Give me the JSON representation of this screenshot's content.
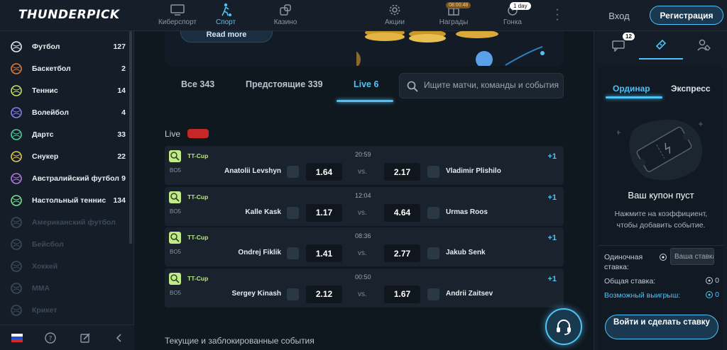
{
  "header": {
    "logo": "THUNDERPICK",
    "nav": [
      {
        "label": "Киберспорт",
        "icon": "monitor-icon"
      },
      {
        "label": "Спорт",
        "icon": "soccer-player-icon"
      },
      {
        "label": "Казино",
        "icon": "dice-icon"
      },
      {
        "label": "Акции",
        "icon": "gear-icon"
      },
      {
        "label": "Награды",
        "icon": "gift-icon",
        "badge": "08:00:48"
      },
      {
        "label": "Гонка",
        "icon": "stopwatch-icon",
        "badge": "1 day"
      }
    ],
    "login": "Вход",
    "register": "Регистрация"
  },
  "sidebar": {
    "sports": [
      {
        "name": "Футбол",
        "count": "127",
        "icon": "soccer-ball-icon"
      },
      {
        "name": "Баскетбол",
        "count": "2",
        "icon": "basketball-icon"
      },
      {
        "name": "Теннис",
        "count": "14",
        "icon": "tennis-icon"
      },
      {
        "name": "Волейбол",
        "count": "4",
        "icon": "volleyball-icon"
      },
      {
        "name": "Дартс",
        "count": "33",
        "icon": "darts-icon"
      },
      {
        "name": "Снукер",
        "count": "22",
        "icon": "snooker-icon"
      },
      {
        "name": "Австралийский футбол",
        "count": "9",
        "icon": "aussie-football-icon"
      },
      {
        "name": "Настольный теннис",
        "count": "134",
        "icon": "table-tennis-icon"
      },
      {
        "name": "Американский футбол",
        "count": "",
        "icon": "american-football-icon"
      },
      {
        "name": "Бейсбол",
        "count": "",
        "icon": "baseball-icon"
      },
      {
        "name": "Хоккей",
        "count": "",
        "icon": "hockey-icon"
      },
      {
        "name": "MMA",
        "count": "",
        "icon": "mma-icon"
      },
      {
        "name": "Крикет",
        "count": "",
        "icon": "cricket-icon"
      }
    ]
  },
  "main": {
    "banner_button": "Read more",
    "tabs": [
      {
        "label": "Все 343"
      },
      {
        "label": "Предстоящие 339"
      },
      {
        "label": "Live 6"
      }
    ],
    "search_placeholder": "Ищите матчи, команды и события",
    "live_label": "Live",
    "matches": [
      {
        "league": "TT-Cup",
        "format": "BO5",
        "time": "20:59",
        "home": "Anatolii Levshyn",
        "away": "Vladimir Plishilo",
        "odd_home": "1.64",
        "odd_away": "2.17",
        "more": "+1",
        "vs": "vs."
      },
      {
        "league": "TT-Cup",
        "format": "BO5",
        "time": "12:04",
        "home": "Kalle Kask",
        "away": "Urmas Roos",
        "odd_home": "1.17",
        "odd_away": "4.64",
        "more": "+1",
        "vs": "vs."
      },
      {
        "league": "TT-Cup",
        "format": "BO5",
        "time": "08:36",
        "home": "Ondrej Fiklik",
        "away": "Jakub Senk",
        "odd_home": "1.41",
        "odd_away": "2.77",
        "more": "+1",
        "vs": "vs."
      },
      {
        "league": "TT-Cup",
        "format": "BO5",
        "time": "00:50",
        "home": "Sergey Kinash",
        "away": "Andrii Zaitsev",
        "odd_home": "2.12",
        "odd_away": "1.67",
        "more": "+1",
        "vs": "vs."
      }
    ],
    "section_title": "Текущие и заблокированные события"
  },
  "betslip": {
    "messages_badge": "12",
    "tabs": [
      {
        "label": "Ординар"
      },
      {
        "label": "Экспресс"
      }
    ],
    "empty_title": "Ваш купон пуст",
    "empty_hint": "Нажмите на коэффициент, чтобы добавить событие.",
    "single_stake_label": "Одиночная ставка:",
    "stake_placeholder": "Ваша ставка",
    "total_stake_label": "Общая ставка:",
    "total_stake_value": "0",
    "possible_win_label": "Возможный выигрыш:",
    "possible_win_value": "0",
    "place_button": "Войти и сделать ставку"
  },
  "colors": {
    "accent": "#4fc3f7",
    "league": "#b7ea7c",
    "live": "#c62828"
  }
}
